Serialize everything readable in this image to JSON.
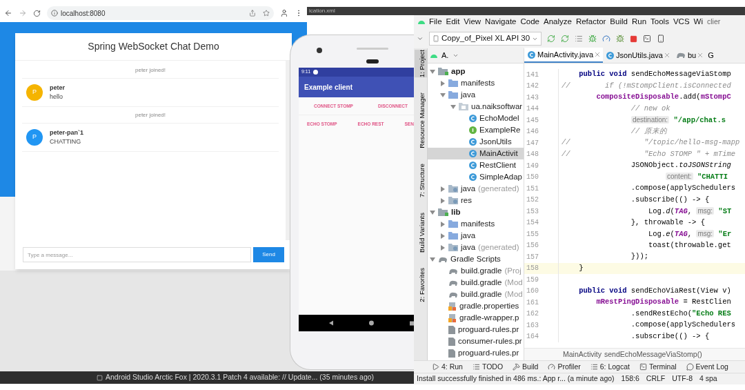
{
  "background_tab": "ication.xml",
  "browser": {
    "url": "localhost:8080",
    "title": "Spring WebSocket Chat Demo",
    "messages": [
      {
        "kind": "event",
        "text": "peter joined!"
      },
      {
        "kind": "chat",
        "avatar": "P",
        "color": "#f5b400",
        "sender": "peter",
        "text": "hello"
      },
      {
        "kind": "event",
        "text": "peter joined!"
      },
      {
        "kind": "chat",
        "avatar": "P",
        "color": "#2196f3",
        "sender": "peter-pan`1",
        "text": "CHATTING"
      }
    ],
    "input": {
      "placeholder": "Type a message..."
    },
    "send_button": "Send"
  },
  "phone": {
    "time": "9:11",
    "app_title": "Example client",
    "button_rows": [
      [
        "CONNECT STOMP",
        "DISCONNECT"
      ],
      [
        "ECHO STOMP",
        "ECHO REST",
        "SEN"
      ]
    ]
  },
  "ide": {
    "menu": [
      "File",
      "Edit",
      "View",
      "Navigate",
      "Code",
      "Analyze",
      "Refactor",
      "Build",
      "Run",
      "Tools",
      "VCS",
      "Wi"
    ],
    "title_fragment": "clier",
    "run_config": "Copy_of_Pixel XL API 30",
    "project_header": "A.",
    "tabs": [
      {
        "label": "MainActivity.java",
        "kind": "class",
        "selected": true
      },
      {
        "label": "JsonUtils.java",
        "kind": "class",
        "selected": false
      },
      {
        "label": "bu",
        "kind": "gradle",
        "selected": false
      }
    ],
    "tab_overflow": "G",
    "tool_strip": [
      {
        "label": "1: Project",
        "selected": true
      },
      {
        "label": "Resource Manager",
        "selected": false
      },
      {
        "label": "7: Structure",
        "selected": false
      },
      {
        "label": "Build Variants",
        "selected": false
      },
      {
        "label": "2: Favorites",
        "selected": false
      }
    ],
    "project_tree": [
      {
        "label": "app",
        "kind": "module",
        "expanded": true,
        "selected": false,
        "children": [
          {
            "label": "manifests",
            "kind": "folder",
            "expanded": false,
            "selected": false
          },
          {
            "label": "java",
            "kind": "folder",
            "expanded": true,
            "selected": false,
            "children": [
              {
                "label": "ua.naiksoftwar",
                "kind": "package",
                "expanded": true,
                "selected": false,
                "children": [
                  {
                    "label": "EchoModel",
                    "kind": "class",
                    "selected": false
                  },
                  {
                    "label": "ExampleRe",
                    "kind": "interface",
                    "selected": false
                  },
                  {
                    "label": "JsonUtils",
                    "kind": "class",
                    "selected": false
                  },
                  {
                    "label": "MainActivit",
                    "kind": "class",
                    "selected": true
                  },
                  {
                    "label": "RestClient",
                    "kind": "class",
                    "selected": false
                  },
                  {
                    "label": "SimpleAdap",
                    "kind": "class",
                    "selected": false
                  }
                ]
              }
            ]
          },
          {
            "label": "java",
            "hint": "(generated)",
            "kind": "generated",
            "expanded": false,
            "selected": false
          },
          {
            "label": "res",
            "kind": "generated",
            "expanded": false,
            "selected": false
          }
        ]
      },
      {
        "label": "lib",
        "kind": "module",
        "expanded": true,
        "selected": false,
        "children": [
          {
            "label": "manifests",
            "kind": "folder",
            "expanded": false,
            "selected": false
          },
          {
            "label": "java",
            "kind": "folder",
            "expanded": false,
            "selected": false
          },
          {
            "label": "java",
            "hint": "(generated)",
            "kind": "generated",
            "expanded": false,
            "selected": false
          }
        ]
      },
      {
        "label": "Gradle Scripts",
        "kind": "gradle",
        "expanded": true,
        "selected": false,
        "children": [
          {
            "label": "build.gradle",
            "hint": "(Proj",
            "kind": "gradle",
            "selected": false
          },
          {
            "label": "build.gradle",
            "hint": "(Mod",
            "kind": "gradle",
            "selected": false
          },
          {
            "label": "build.gradle",
            "hint": "(Mod",
            "kind": "gradle",
            "selected": false
          },
          {
            "label": "gradle.properties",
            "kind": "properties",
            "selected": false
          },
          {
            "label": "gradle-wrapper.p",
            "kind": "properties",
            "selected": false
          },
          {
            "label": "proguard-rules.pr",
            "kind": "file",
            "selected": false
          },
          {
            "label": "consumer-rules.pr",
            "kind": "file",
            "selected": false
          },
          {
            "label": "proguard-rules.pr",
            "kind": "file",
            "selected": false
          }
        ]
      }
    ],
    "code_lines": [
      {
        "number": "141",
        "current": false,
        "segments": [
          {
            "kind": "kw",
            "text": "    public void "
          },
          {
            "kind": "plain",
            "text": "sendEchoMessageViaStomp"
          }
        ]
      },
      {
        "number": "142",
        "current": false,
        "segments": [
          {
            "kind": "comment",
            "text": "//        if (!mStompClient.isConnected"
          }
        ]
      },
      {
        "number": "143",
        "current": false,
        "segments": [
          {
            "kind": "field",
            "text": "        compositeDisposable"
          },
          {
            "kind": "plain",
            "text": ".add("
          },
          {
            "kind": "field",
            "text": "mStompC"
          }
        ]
      },
      {
        "number": "144",
        "current": false,
        "segments": [
          {
            "kind": "comment",
            "text": "                // new ok"
          }
        ]
      },
      {
        "number": "145",
        "current": false,
        "segments": [
          {
            "kind": "hint",
            "indented": true,
            "text": "destination:"
          },
          {
            "kind": "string",
            "text": " \"/app/chat.s"
          }
        ]
      },
      {
        "number": "146",
        "current": false,
        "segments": [
          {
            "kind": "comment",
            "text": "                // 原来的"
          }
        ]
      },
      {
        "number": "147",
        "current": false,
        "segments": [
          {
            "kind": "comment",
            "text": "//                 \"/topic/hello-msg-mapp"
          }
        ]
      },
      {
        "number": "148",
        "current": false,
        "segments": [
          {
            "kind": "comment",
            "text": "//                 \"Echo STOMP \" + mTime"
          }
        ]
      },
      {
        "number": "149",
        "current": false,
        "segments": [
          {
            "kind": "plain",
            "text": "                JSONObject."
          },
          {
            "kind": "static",
            "text": "toJSONString"
          }
        ]
      },
      {
        "number": "150",
        "current": false,
        "segments": [
          {
            "kind": "hint",
            "indented": true,
            "text": "content:"
          },
          {
            "kind": "string",
            "text": " \"CHATTI"
          }
        ]
      },
      {
        "number": "151",
        "current": false,
        "segments": [
          {
            "kind": "plain",
            "text": "                .compose(applySchedulers"
          }
        ]
      },
      {
        "number": "152",
        "current": false,
        "segments": [
          {
            "kind": "plain",
            "text": "                .subscribe(() -> {"
          }
        ]
      },
      {
        "number": "153",
        "current": false,
        "segments": [
          {
            "kind": "plain",
            "text": "                    Log."
          },
          {
            "kind": "static",
            "text": "d"
          },
          {
            "kind": "plain",
            "text": "("
          },
          {
            "kind": "constant",
            "text": "TAG"
          },
          {
            "kind": "plain",
            "text": ", "
          },
          {
            "kind": "hint",
            "text": "msg:"
          },
          {
            "kind": "string",
            "text": " \"ST"
          }
        ]
      },
      {
        "number": "154",
        "current": false,
        "segments": [
          {
            "kind": "plain",
            "text": "                }, throwable -> {"
          }
        ]
      },
      {
        "number": "155",
        "current": false,
        "segments": [
          {
            "kind": "plain",
            "text": "                    Log."
          },
          {
            "kind": "static",
            "text": "e"
          },
          {
            "kind": "plain",
            "text": "("
          },
          {
            "kind": "constant",
            "text": "TAG"
          },
          {
            "kind": "plain",
            "text": ", "
          },
          {
            "kind": "hint",
            "text": "msg:"
          },
          {
            "kind": "string",
            "text": " \"Er"
          }
        ]
      },
      {
        "number": "156",
        "current": false,
        "segments": [
          {
            "kind": "plain",
            "text": "                    toast(throwable.get"
          }
        ]
      },
      {
        "number": "157",
        "current": false,
        "segments": [
          {
            "kind": "plain",
            "text": "                }));"
          }
        ]
      },
      {
        "number": "158",
        "current": true,
        "segments": [
          {
            "kind": "plain",
            "text": "    }"
          }
        ]
      },
      {
        "number": "159",
        "current": false
      },
      {
        "number": "160",
        "current": false,
        "segments": [
          {
            "kind": "kw",
            "text": "    public void "
          },
          {
            "kind": "plain",
            "text": "sendEchoViaRest(View v)"
          }
        ]
      },
      {
        "number": "161",
        "current": false,
        "segments": [
          {
            "kind": "field",
            "text": "        mRestPingDisposable"
          },
          {
            "kind": "plain",
            "text": " = RestClien"
          }
        ]
      },
      {
        "number": "162",
        "current": false,
        "segments": [
          {
            "kind": "plain",
            "text": "                .sendRestEcho("
          },
          {
            "kind": "string",
            "text": "\"Echo RES"
          }
        ]
      },
      {
        "number": "163",
        "current": false,
        "segments": [
          {
            "kind": "plain",
            "text": "                .compose(applySchedulers"
          }
        ]
      },
      {
        "number": "164",
        "current": false,
        "segments": [
          {
            "kind": "plain",
            "text": "                .subscribe(() -> {"
          }
        ]
      }
    ],
    "breadcrumb": [
      "MainActivity",
      "sendEchoMessageViaStomp()"
    ],
    "tool_windows": [
      {
        "label": "4: Run",
        "kind": "run"
      },
      {
        "label": "TODO",
        "kind": "list"
      },
      {
        "label": "Build",
        "kind": "hammer"
      },
      {
        "label": "Profiler",
        "kind": "gauge"
      },
      {
        "label": "6: Logcat",
        "kind": "list"
      },
      {
        "label": "Terminal",
        "kind": "terminal"
      },
      {
        "label": "Event Log",
        "kind": "bubble"
      }
    ],
    "status": {
      "message": "Install successfully finished in 486 ms.: App r... (a minute ago)",
      "items": [
        "158:6",
        "CRLF",
        "UTF-8",
        "4 spa"
      ]
    }
  },
  "notification": "Android Studio Arctic Fox | 2020.3.1 Patch 4 available: // Update... (35 minutes ago)"
}
